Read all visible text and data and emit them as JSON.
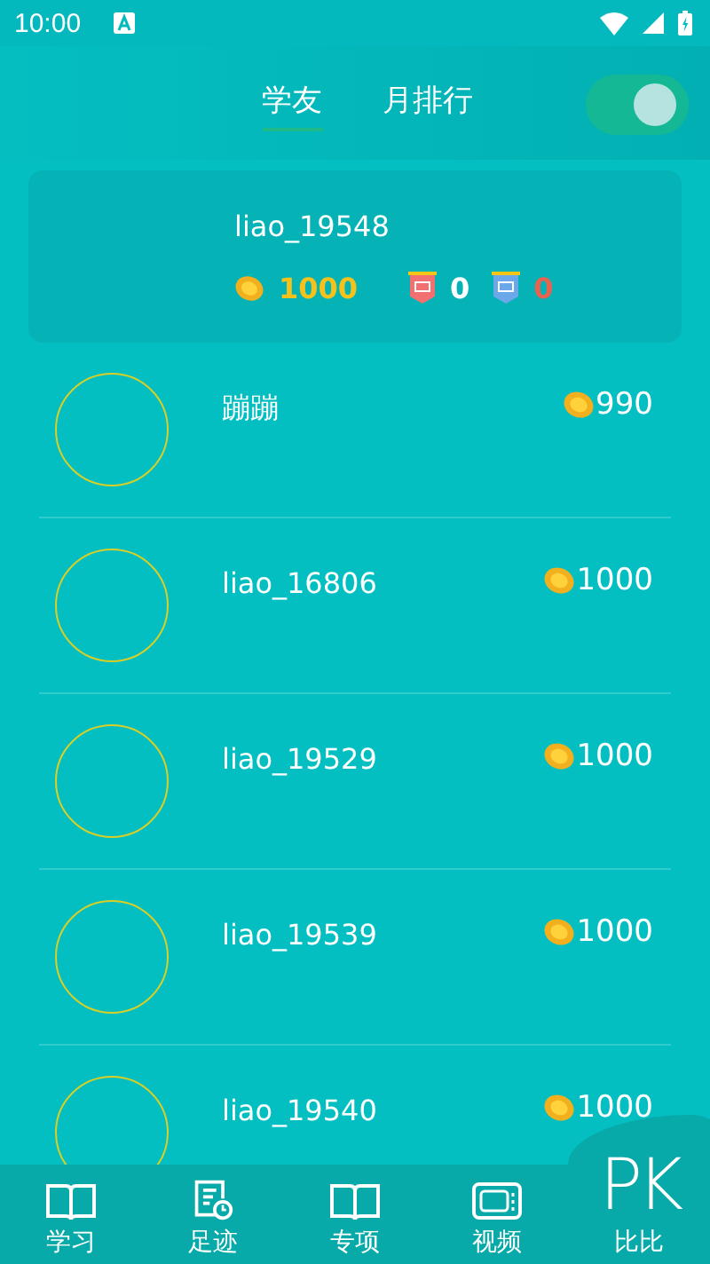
{
  "status_bar": {
    "time": "10:00"
  },
  "tabs": [
    {
      "label": "学友",
      "selected": true
    },
    {
      "label": "月排行",
      "selected": false
    }
  ],
  "toggle": {
    "on": true
  },
  "me": {
    "name": "liao_19548",
    "coins": "1000",
    "red_count": "0",
    "blue_count": "0"
  },
  "rows": [
    {
      "name": "蹦蹦",
      "coins": "990"
    },
    {
      "name": "liao_16806",
      "coins": "1000"
    },
    {
      "name": "liao_19529",
      "coins": "1000"
    },
    {
      "name": "liao_19539",
      "coins": "1000"
    },
    {
      "name": "liao_19540",
      "coins": "1000"
    }
  ],
  "nav": [
    {
      "kind": "book",
      "label": "学习",
      "selected": false
    },
    {
      "kind": "history",
      "label": "足迹",
      "selected": false
    },
    {
      "kind": "book",
      "label": "专项",
      "selected": false
    },
    {
      "kind": "tv",
      "label": "视频",
      "selected": false
    },
    {
      "kind": "pk",
      "label": "比比",
      "glyph": "PK",
      "selected": true
    }
  ]
}
